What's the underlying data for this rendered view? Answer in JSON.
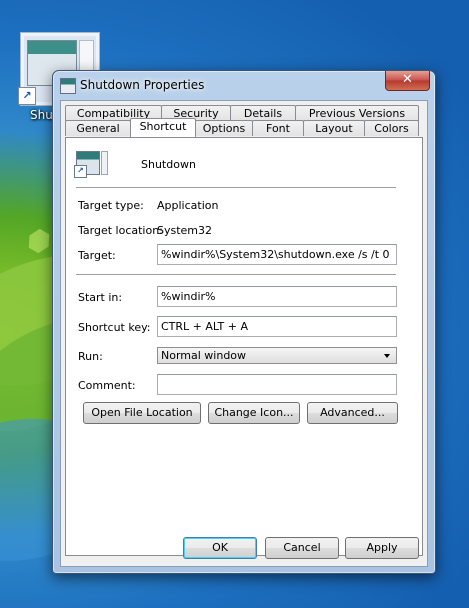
{
  "desktop": {
    "icon_label": "Shutd"
  },
  "window": {
    "title": "Shutdown Properties",
    "close_glyph": "✕"
  },
  "tabs": {
    "row1": [
      "Compatibility",
      "Security",
      "Details",
      "Previous Versions"
    ],
    "row2": [
      "General",
      "Shortcut",
      "Options",
      "Font",
      "Layout",
      "Colors"
    ],
    "active": "Shortcut"
  },
  "shortcut": {
    "name": "Shutdown",
    "target_type_label": "Target type:",
    "target_type_value": "Application",
    "target_location_label": "Target location:",
    "target_location_value": "System32",
    "target_label": "Target:",
    "target_value": "%windir%\\System32\\shutdown.exe /s /t 0",
    "start_in_label": "Start in:",
    "start_in_value": "%windir%",
    "shortcut_key_label": "Shortcut key:",
    "shortcut_key_value": "CTRL + ALT + A",
    "run_label": "Run:",
    "run_value": "Normal window",
    "comment_label": "Comment:",
    "comment_value": ""
  },
  "actions": {
    "open_file_location": "Open File Location",
    "change_icon": "Change Icon...",
    "advanced": "Advanced..."
  },
  "footer": {
    "ok": "OK",
    "cancel": "Cancel",
    "apply": "Apply"
  }
}
